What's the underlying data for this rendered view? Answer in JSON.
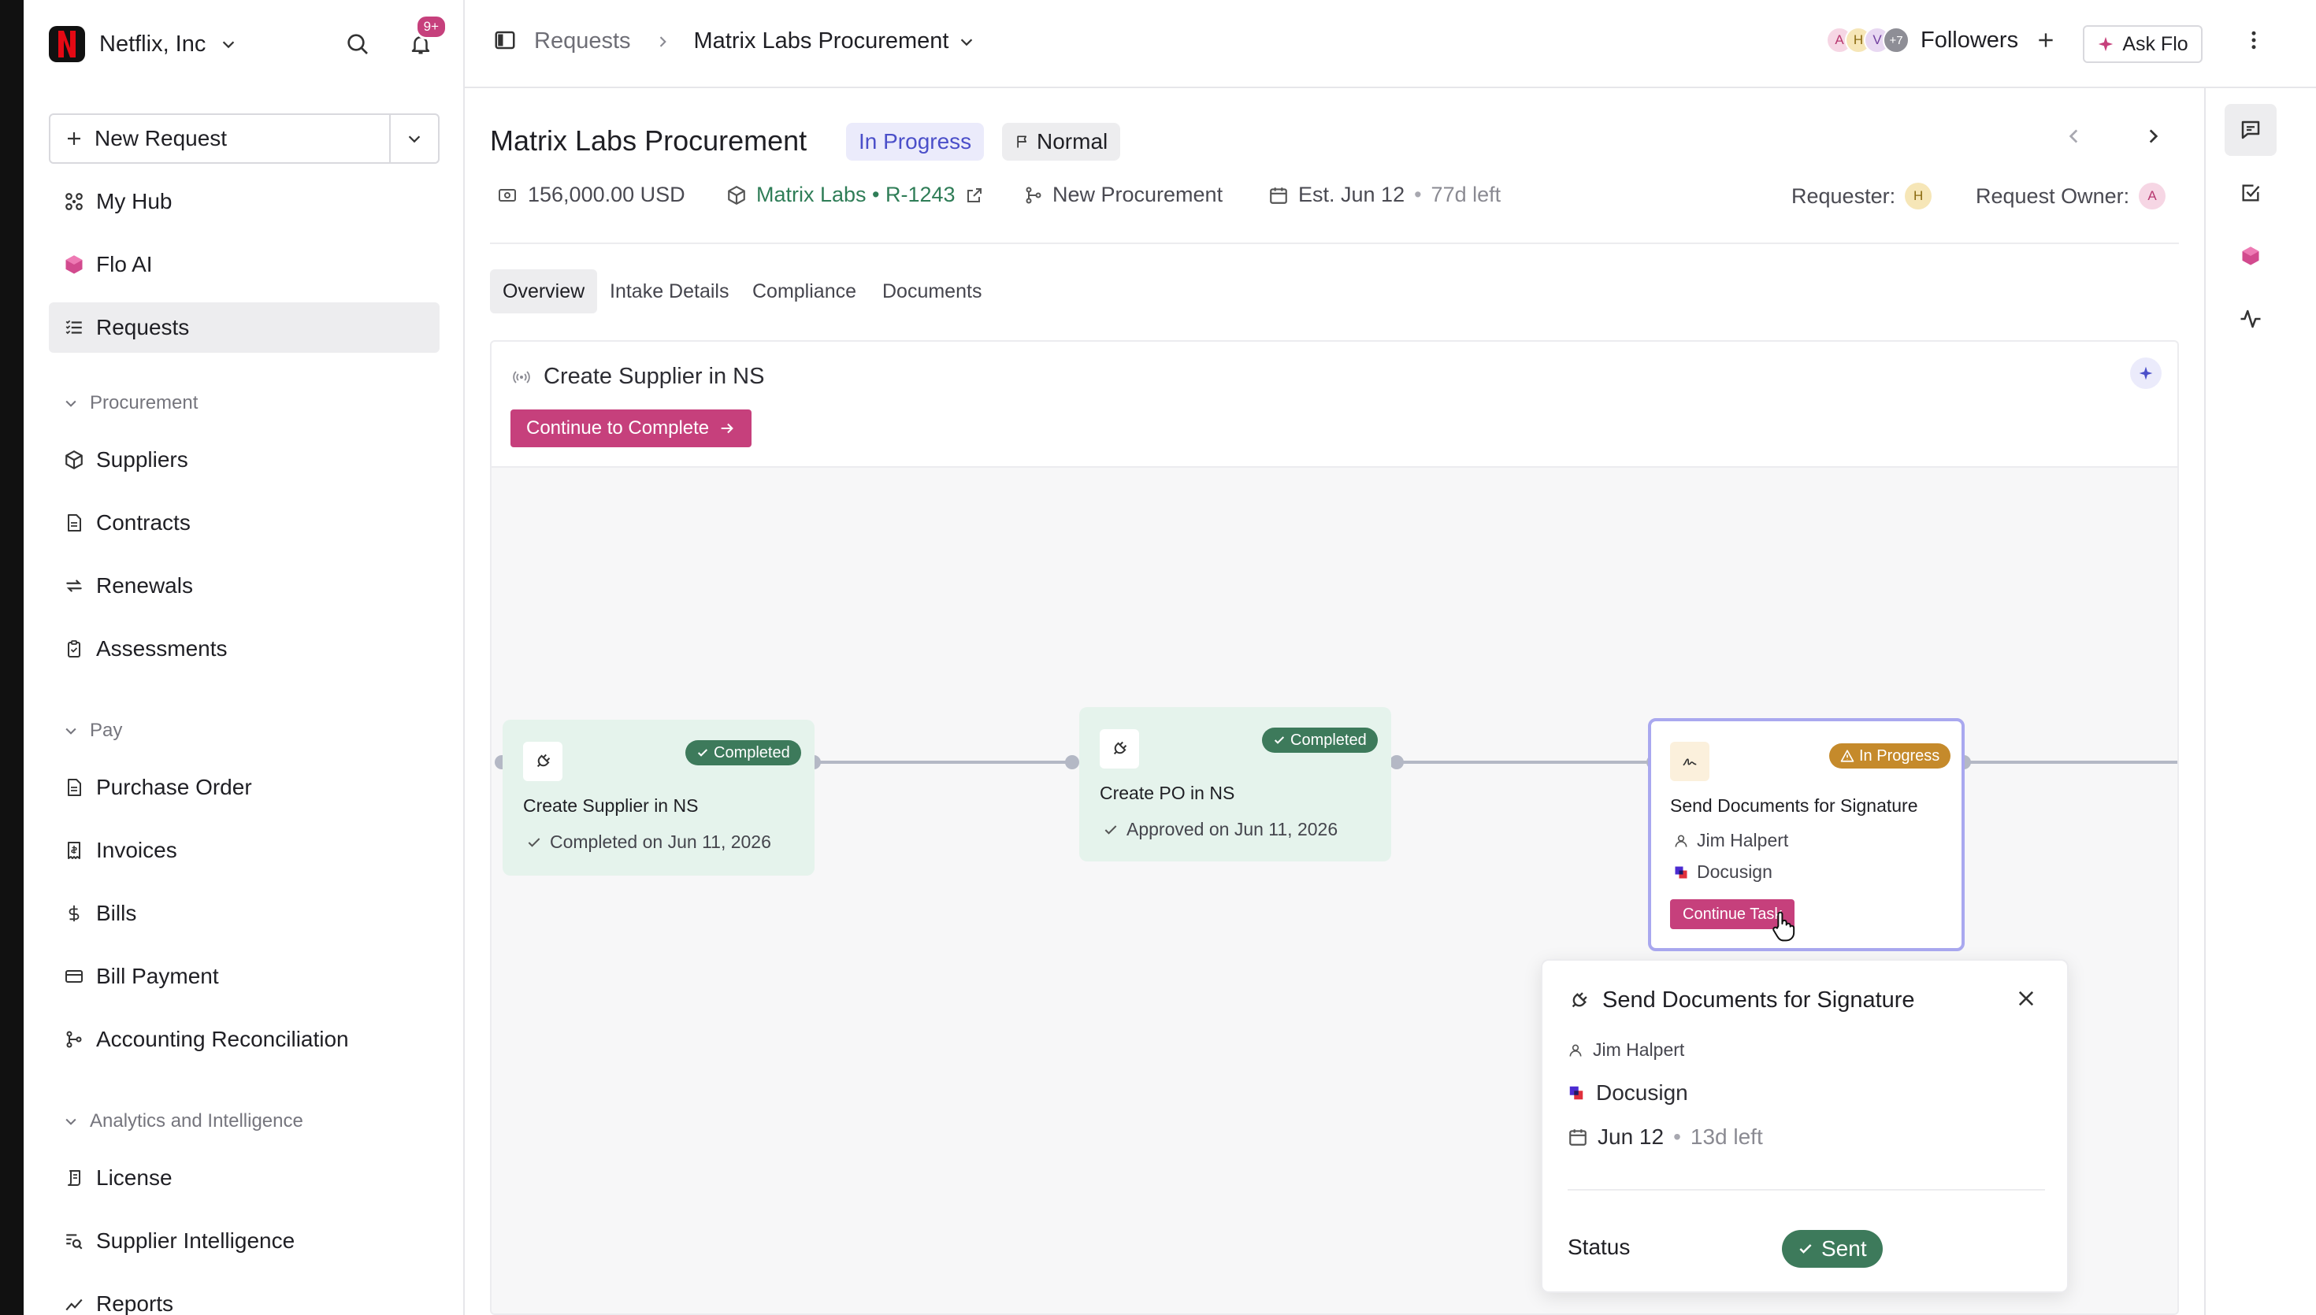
{
  "org": {
    "name": "Netflix, Inc",
    "notif_count": "9+"
  },
  "sidebar": {
    "new_request": "New Request",
    "top_items": [
      {
        "label": "My Hub",
        "icon": "hub-icon"
      },
      {
        "label": "Flo AI",
        "icon": "flo-ai-icon"
      },
      {
        "label": "Requests",
        "icon": "requests-icon",
        "active": true
      }
    ],
    "procurement": {
      "heading": "Procurement",
      "items": [
        {
          "label": "Suppliers",
          "icon": "box-icon"
        },
        {
          "label": "Contracts",
          "icon": "document-icon"
        },
        {
          "label": "Renewals",
          "icon": "renew-icon"
        },
        {
          "label": "Assessments",
          "icon": "clipboard-icon"
        }
      ]
    },
    "pay": {
      "heading": "Pay",
      "items": [
        {
          "label": "Purchase Order",
          "icon": "document-icon"
        },
        {
          "label": "Invoices",
          "icon": "receipt-icon"
        },
        {
          "label": "Bills",
          "icon": "dollar-icon"
        },
        {
          "label": "Bill Payment",
          "icon": "card-icon"
        },
        {
          "label": "Accounting Reconciliation",
          "icon": "branch-icon"
        }
      ]
    },
    "analytics": {
      "heading": "Analytics and Intelligence",
      "items": [
        {
          "label": "License",
          "icon": "license-icon"
        },
        {
          "label": "Supplier Intelligence",
          "icon": "search-list-icon"
        },
        {
          "label": "Reports",
          "icon": "chart-line-icon"
        }
      ]
    }
  },
  "header": {
    "breadcrumb_root": "Requests",
    "breadcrumb_current": "Matrix Labs Procurement",
    "followers_label": "Followers",
    "followers_avatars": [
      "A",
      "H",
      "V"
    ],
    "followers_more": "+7",
    "ask_flo": "Ask Flo"
  },
  "request": {
    "title": "Matrix Labs Procurement",
    "status": "In Progress",
    "priority": "Normal",
    "amount": "156,000.00 USD",
    "supplier_link": "Matrix Labs • R-1243",
    "workflow": "New Procurement",
    "est_date": "Est. Jun 12",
    "days_left": "77d left",
    "requester_label": "Requester:",
    "requester_initial": "H",
    "owner_label": "Request Owner:",
    "owner_initial": "A"
  },
  "tabs": [
    "Overview",
    "Intake Details",
    "Compliance",
    "Documents"
  ],
  "workflow": {
    "step_title": "Create Supplier in NS",
    "continue_button": "Continue to Complete",
    "nodes": [
      {
        "title": "Create Supplier in NS",
        "status": "Completed",
        "detail": "Completed on Jun 11, 2026"
      },
      {
        "title": "Create PO in NS",
        "status": "Completed",
        "detail": "Approved on Jun 11, 2026"
      },
      {
        "title": "Send Documents for Signature",
        "status": "In Progress",
        "assignee": "Jim Halpert",
        "app": "Docusign",
        "button": "Continue Task"
      }
    ]
  },
  "popover": {
    "title": "Send Documents for Signature",
    "assignee": "Jim Halpert",
    "app": "Docusign",
    "date": "Jun 12",
    "days_left": "13d left",
    "status_label": "Status",
    "status_value": "Sent"
  },
  "colors": {
    "accent_pink": "#c6407c",
    "status_purple_bg": "#ebebfb",
    "status_purple_text": "#4b4fc9",
    "completed_green": "#3d7a5b",
    "in_progress_orange": "#c58a2b",
    "link_green": "#2f7d57"
  }
}
